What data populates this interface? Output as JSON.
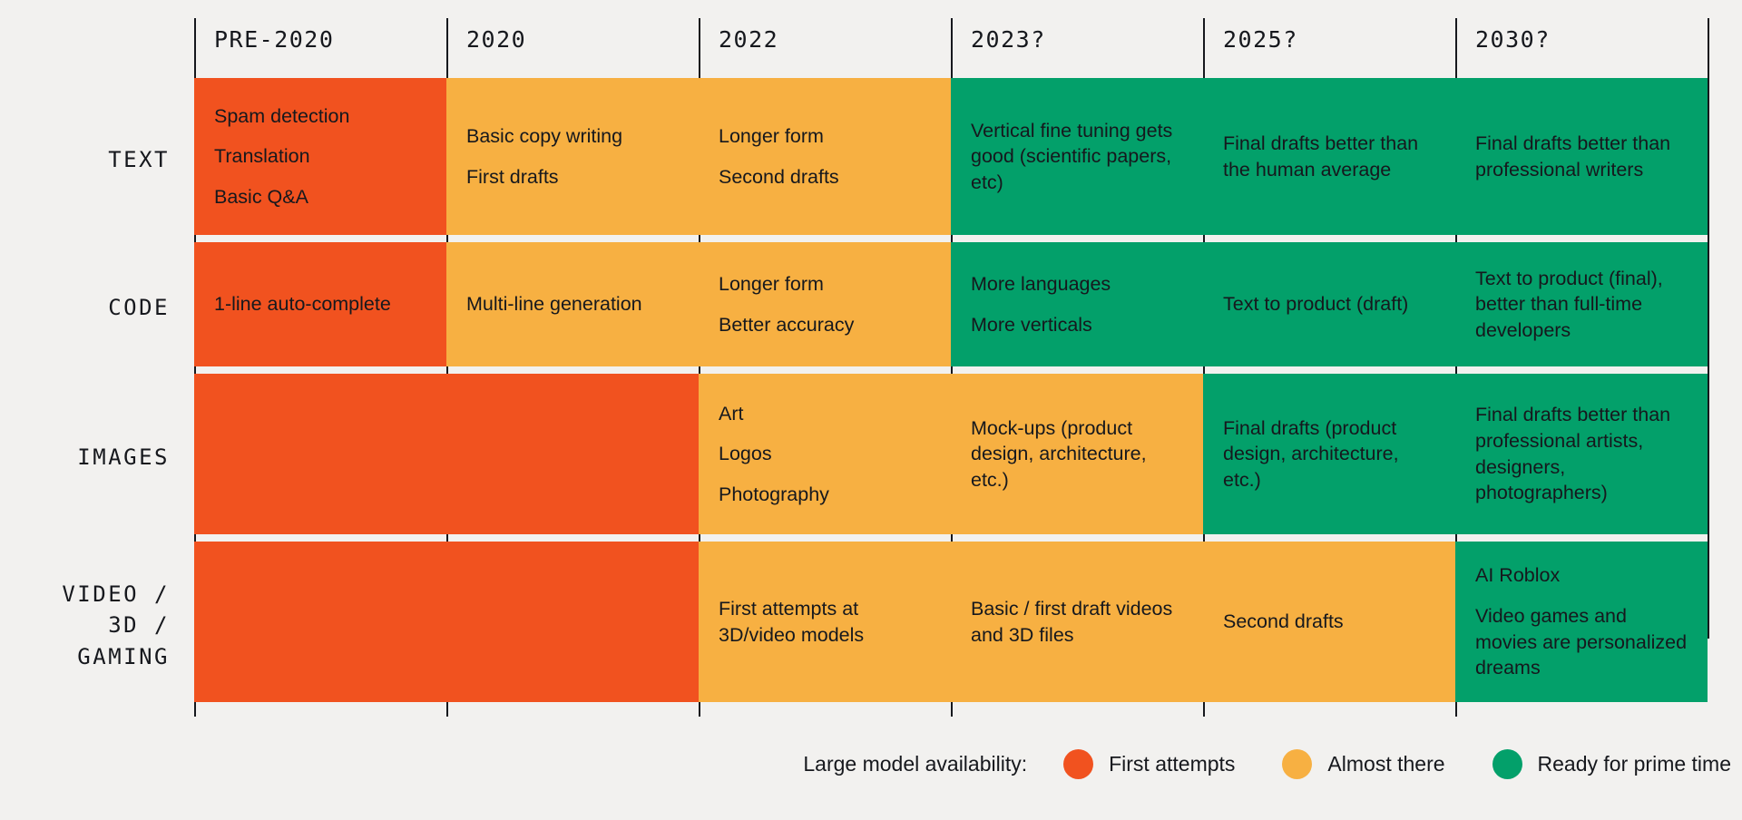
{
  "columns": [
    "PRE-2020",
    "2020",
    "2022",
    "2023?",
    "2025?",
    "2030?"
  ],
  "rows": [
    {
      "label_lines": [
        "TEXT"
      ],
      "cells": [
        {
          "status": "red",
          "lines": [
            "Spam detection",
            "Translation",
            "Basic Q&A"
          ]
        },
        {
          "status": "amber",
          "lines": [
            "Basic copy writing",
            "First drafts"
          ]
        },
        {
          "status": "amber",
          "lines": [
            "Longer form",
            "Second drafts"
          ]
        },
        {
          "status": "green",
          "lines": [
            "Vertical fine tuning gets good (scientific papers, etc)"
          ]
        },
        {
          "status": "green",
          "lines": [
            "Final drafts better than the human average"
          ]
        },
        {
          "status": "green",
          "lines": [
            "Final drafts better than professional writers"
          ]
        }
      ]
    },
    {
      "label_lines": [
        "CODE"
      ],
      "cells": [
        {
          "status": "red",
          "lines": [
            "1-line auto-complete"
          ]
        },
        {
          "status": "amber",
          "lines": [
            "Multi-line generation"
          ]
        },
        {
          "status": "amber",
          "lines": [
            "Longer form",
            "Better accuracy"
          ]
        },
        {
          "status": "green",
          "lines": [
            "More languages",
            "More verticals"
          ]
        },
        {
          "status": "green",
          "lines": [
            "Text to product (draft)"
          ]
        },
        {
          "status": "green",
          "lines": [
            "Text to product (final), better than full-time developers"
          ]
        }
      ]
    },
    {
      "label_lines": [
        "IMAGES"
      ],
      "cells": [
        {
          "status": "red",
          "lines": []
        },
        {
          "status": "red",
          "lines": []
        },
        {
          "status": "amber",
          "lines": [
            "Art",
            "Logos",
            "Photography"
          ]
        },
        {
          "status": "amber",
          "lines": [
            "Mock-ups (product design, architecture, etc.)"
          ]
        },
        {
          "status": "green",
          "lines": [
            "Final drafts (product design, architecture, etc.)"
          ]
        },
        {
          "status": "green",
          "lines": [
            "Final drafts better than professional artists, designers, photographers)"
          ]
        }
      ]
    },
    {
      "label_lines": [
        "VIDEO /",
        "3D /",
        "GAMING"
      ],
      "cells": [
        {
          "status": "red",
          "lines": []
        },
        {
          "status": "red",
          "lines": []
        },
        {
          "status": "amber",
          "lines": [
            "First attempts at 3D/video models"
          ]
        },
        {
          "status": "amber",
          "lines": [
            "Basic / first draft videos and 3D files"
          ]
        },
        {
          "status": "amber",
          "lines": [
            "Second drafts"
          ]
        },
        {
          "status": "green",
          "lines": [
            "AI Roblox",
            "Video games and movies are personalized dreams"
          ]
        }
      ]
    }
  ],
  "legend": {
    "title": "Large model availability:",
    "items": [
      {
        "label": "First attempts",
        "color": "#f1521f"
      },
      {
        "label": "Almost there",
        "color": "#f7b042"
      },
      {
        "label": "Ready for prime time",
        "color": "#03a06a"
      }
    ]
  },
  "colors": {
    "background": "#f2f1ef",
    "red": "#f1521f",
    "amber": "#f7b042",
    "green": "#03a06a",
    "ink": "#16181d"
  }
}
